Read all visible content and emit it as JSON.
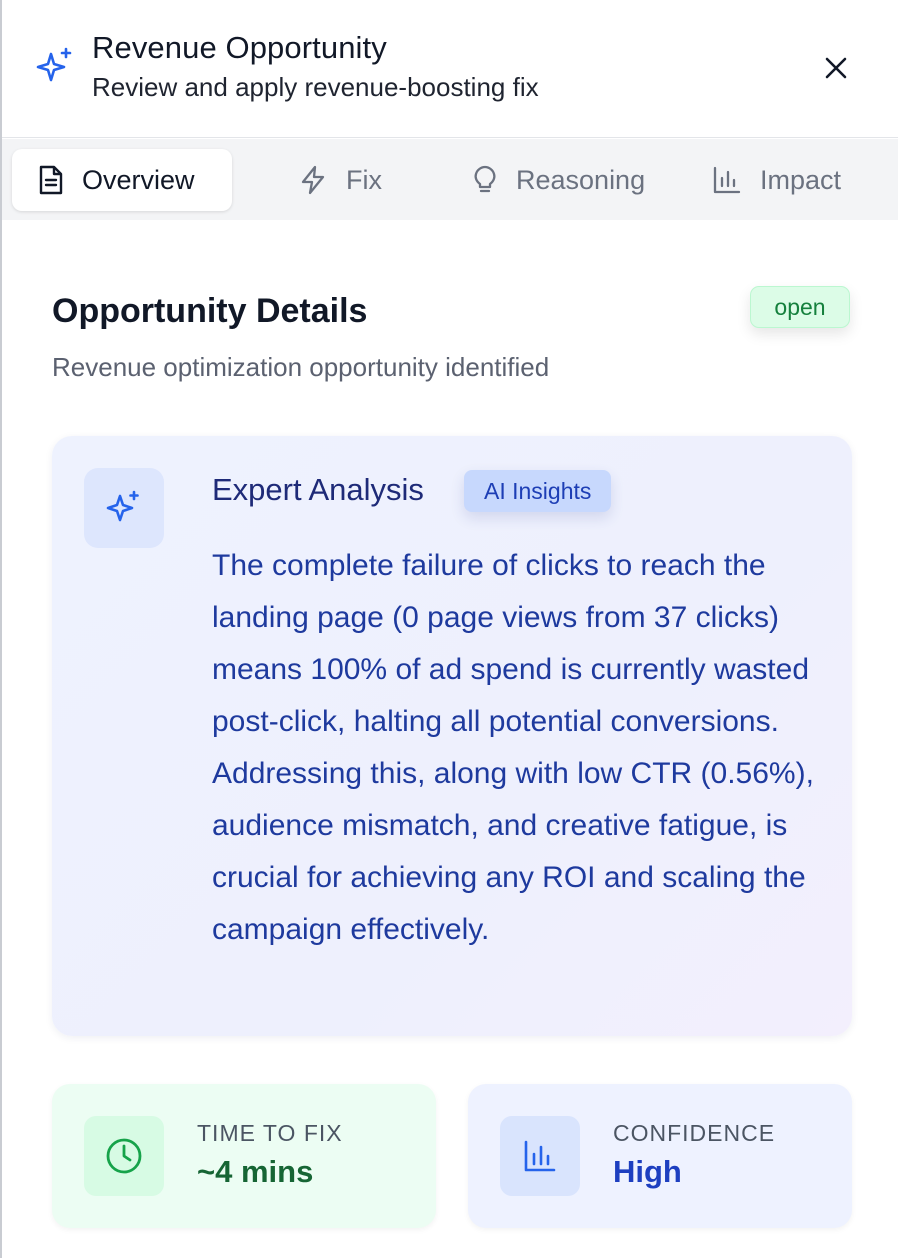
{
  "header": {
    "title": "Revenue Opportunity",
    "subtitle": "Review and apply revenue-boosting fix",
    "icon": "sparkles-icon",
    "close_icon": "close-icon"
  },
  "tabs": [
    {
      "label": "Overview",
      "icon": "document-icon",
      "active": true
    },
    {
      "label": "Fix",
      "icon": "lightning-icon",
      "active": false
    },
    {
      "label": "Reasoning",
      "icon": "lightbulb-icon",
      "active": false
    },
    {
      "label": "Impact",
      "icon": "bar-chart-icon",
      "active": false
    }
  ],
  "details": {
    "title": "Opportunity Details",
    "subtitle": "Revenue optimization opportunity identified",
    "status": "open"
  },
  "analysis": {
    "title": "Expert Analysis",
    "badge": "AI Insights",
    "text": "The complete failure of clicks to reach the landing page (0 page views from 37 clicks) means 100% of ad spend is currently wasted post-click, halting all potential conversions. Addressing this, along with low CTR (0.56%), audience mismatch, and creative fatigue, is crucial for achieving any ROI and scaling the campaign effectively."
  },
  "stats": {
    "time_to_fix": {
      "label": "TIME TO FIX",
      "value": "~4 mins",
      "icon": "clock-icon"
    },
    "confidence": {
      "label": "CONFIDENCE",
      "value": "High",
      "icon": "bar-chart-icon"
    }
  },
  "colors": {
    "accent_blue": "#2563eb",
    "status_green": "#15803d",
    "analysis_text": "#1e3a9e"
  }
}
